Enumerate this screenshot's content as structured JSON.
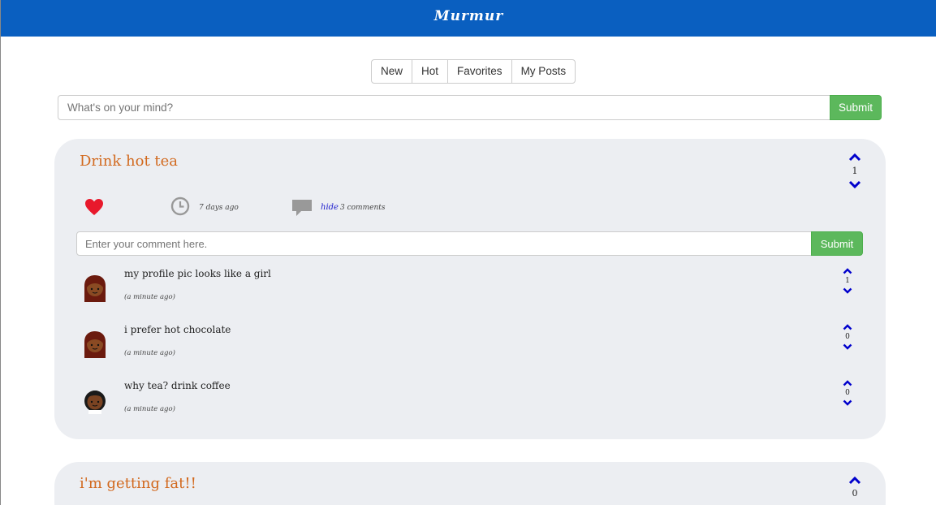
{
  "header": {
    "logo": "Murmur"
  },
  "tabs": [
    {
      "label": "New"
    },
    {
      "label": "Hot"
    },
    {
      "label": "Favorites"
    },
    {
      "label": "My Posts"
    }
  ],
  "composer": {
    "placeholder": "What's on your mind?",
    "submit_label": "Submit"
  },
  "posts": [
    {
      "title": "Drink hot tea",
      "votes": "1",
      "time": "7 days ago",
      "hide_label": "hide",
      "comment_count": "3 comments",
      "comment_placeholder": "Enter your comment here.",
      "comment_submit_label": "Submit",
      "comments": [
        {
          "text": "my profile pic looks like a girl",
          "time": "(a minute ago)",
          "votes": "1"
        },
        {
          "text": "i prefer hot chocolate",
          "time": "(a minute ago)",
          "votes": "0"
        },
        {
          "text": "why tea? drink coffee",
          "time": "(a minute ago)",
          "votes": "0"
        }
      ]
    },
    {
      "title": "i'm getting fat!!",
      "votes": "0"
    }
  ],
  "colors": {
    "header_bg": "#0a5fc0",
    "submit_green": "#5cb85c",
    "post_title": "#d2691e",
    "vote_arrow": "#0000cc",
    "heart": "#e8192c",
    "card_bg": "#eceef2"
  }
}
